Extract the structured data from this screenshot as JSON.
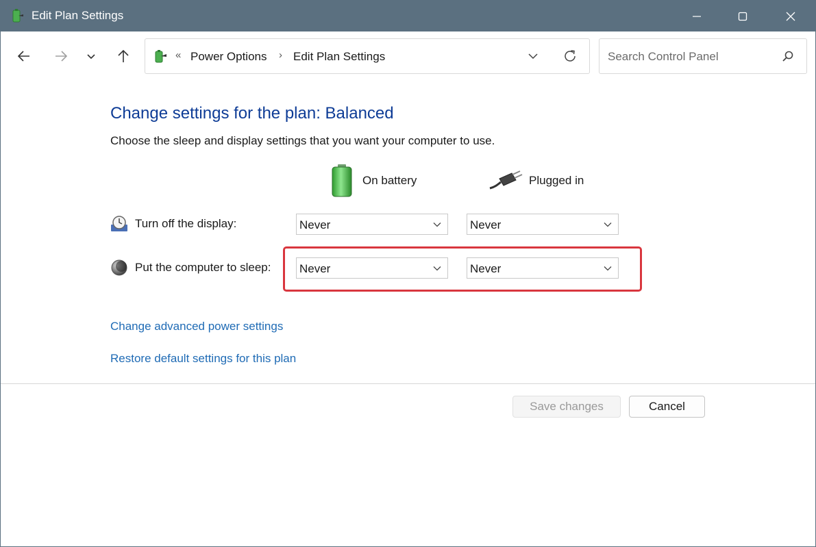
{
  "window": {
    "title": "Edit Plan Settings",
    "icons": {
      "app": "power-options-icon",
      "minimize": "minimize-icon",
      "maximize": "maximize-icon",
      "close": "close-icon"
    }
  },
  "nav": {
    "back_icon": "arrow-left-icon",
    "forward_icon": "arrow-right-icon",
    "recent_icon": "chevron-down-icon",
    "up_icon": "arrow-up-icon",
    "address": {
      "overflow": "«",
      "separator": "›",
      "crumbs": [
        "Power Options",
        "Edit Plan Settings"
      ]
    },
    "search": {
      "placeholder": "Search Control Panel"
    }
  },
  "content": {
    "heading": "Change settings for the plan: Balanced",
    "description": "Choose the sleep and display settings that you want your computer to use.",
    "columns": {
      "battery": "On battery",
      "plugged": "Plugged in"
    },
    "rows": [
      {
        "label": "Turn off the display:",
        "battery_value": "Never",
        "plugged_value": "Never"
      },
      {
        "label": "Put the computer to sleep:",
        "battery_value": "Never",
        "plugged_value": "Never"
      }
    ],
    "links": {
      "advanced": "Change advanced power settings",
      "restore": "Restore default settings for this plan"
    }
  },
  "buttons": {
    "save": "Save changes",
    "cancel": "Cancel"
  },
  "colors": {
    "titlebar": "#5b7080",
    "heading": "#0e3c96",
    "link": "#1f6bb5",
    "highlight": "#d9363e"
  }
}
